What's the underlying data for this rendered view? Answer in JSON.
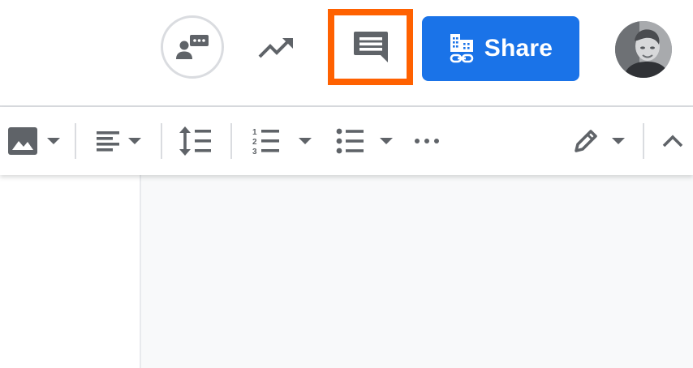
{
  "header": {
    "meet_icon": "present-to-meeting-icon",
    "activity_icon": "trending-up-icon",
    "comments_icon": "comment-icon",
    "share": {
      "label": "Share",
      "icon": "domain-link-icon",
      "color": "#1a73e8"
    },
    "avatar_icon": "user-avatar",
    "highlight_color": "#ff6100"
  },
  "toolbar": {
    "items": [
      {
        "icon": "image-icon",
        "has_dropdown": true
      },
      {
        "icon": "align-left-icon",
        "has_dropdown": true
      },
      {
        "icon": "line-spacing-icon",
        "has_dropdown": false
      },
      {
        "icon": "numbered-list-icon",
        "has_dropdown": true
      },
      {
        "icon": "bulleted-list-icon",
        "has_dropdown": true
      },
      {
        "icon": "more-horizontal-icon",
        "has_dropdown": false
      },
      {
        "icon": "pencil-edit-icon",
        "has_dropdown": true
      },
      {
        "icon": "chevron-up-icon",
        "has_dropdown": false
      }
    ]
  }
}
